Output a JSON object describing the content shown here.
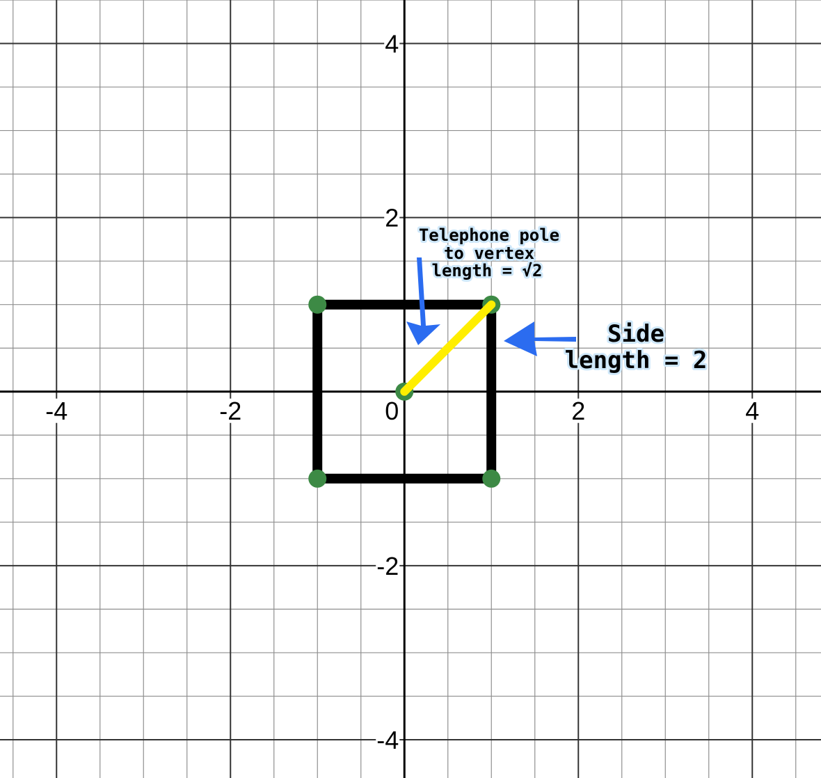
{
  "graph": {
    "x_range": [
      -4.65,
      4.79
    ],
    "y_range": [
      -4.44,
      4.5
    ],
    "minor_step": 0.5,
    "major_step": 2,
    "x_tick_labels": [
      {
        "value": -4,
        "label": "-4"
      },
      {
        "value": -2,
        "label": "-2"
      },
      {
        "value": 0,
        "label": "0"
      },
      {
        "value": 2,
        "label": "2"
      },
      {
        "value": 4,
        "label": "4"
      }
    ],
    "y_tick_labels": [
      {
        "value": 4,
        "label": "4"
      },
      {
        "value": 2,
        "label": "2"
      },
      {
        "value": -2,
        "label": "-2"
      },
      {
        "value": -4,
        "label": "-4"
      }
    ]
  },
  "square": {
    "vertices": [
      [
        -1,
        1
      ],
      [
        1,
        1
      ],
      [
        1,
        -1
      ],
      [
        -1,
        -1
      ]
    ],
    "stroke_color": "#000000",
    "vertex_color": "#3d8a45"
  },
  "pole_segment": {
    "from": [
      0,
      0
    ],
    "to": [
      1,
      1
    ],
    "color": "#ffee00",
    "origin_point_color": "#3d8a45"
  },
  "annotations": {
    "pole_label": [
      "Telephone pole",
      "to vertex",
      "length = √2"
    ],
    "side_label": [
      "Side",
      "length = 2"
    ],
    "arrow_color": "#2b6cf0",
    "highlight_color": "#cfe8fa"
  }
}
